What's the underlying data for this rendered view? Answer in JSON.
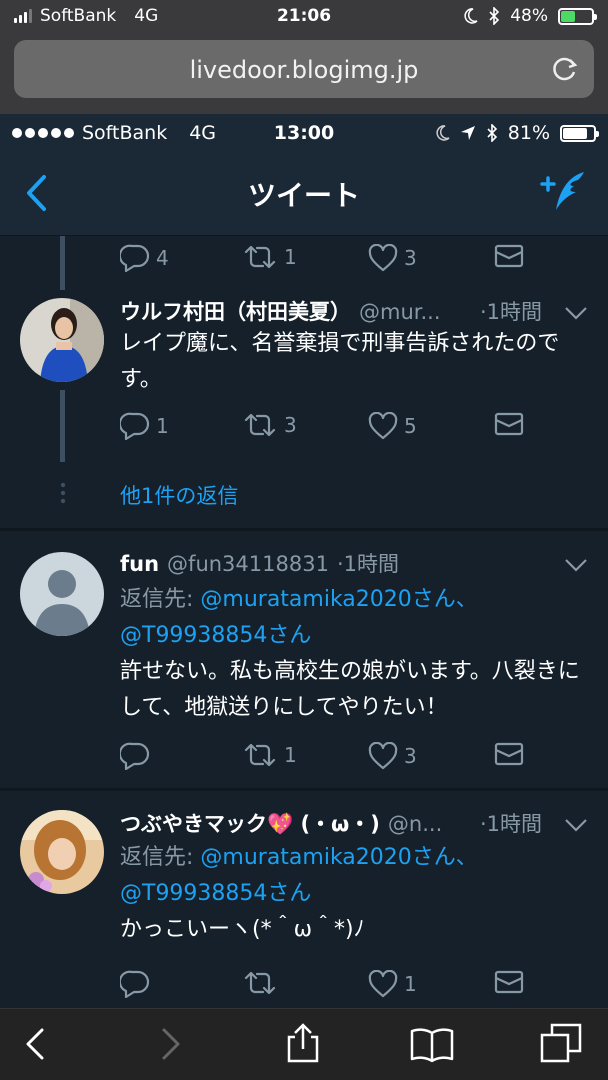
{
  "outer_status": {
    "carrier": "SoftBank",
    "network": "4G",
    "time": "21:06",
    "battery": "48%",
    "battery_color": "#4cd964"
  },
  "browser": {
    "url": "livedoor.blogimg.jp"
  },
  "inner_status": {
    "carrier": "SoftBank",
    "network": "4G",
    "time": "13:00",
    "battery": "81%"
  },
  "nav": {
    "title": "ツイート"
  },
  "top_actions": {
    "replies": "4",
    "retweets": "1",
    "likes": "3"
  },
  "tweets": [
    {
      "name": "ウルフ村田（村田美夏）",
      "handle": "@mur...",
      "time": "·1時間",
      "text": "レイプ魔に、名誉棄損で刑事告訴されたのです。",
      "replies": "1",
      "retweets": "3",
      "likes": "5"
    },
    {
      "name": "fun",
      "handle": "@fun34118831",
      "time": "·1時間",
      "reply_prefix": "返信先: ",
      "reply_mentions": "@muratamika2020さん、",
      "reply_mentions2": "@T99938854さん",
      "text": "許せない。私も高校生の娘がいます。八裂きにして、地獄送りにしてやりたい！",
      "replies": "",
      "retweets": "1",
      "likes": "3"
    },
    {
      "name": "つぶやきマック💖 (・ω・)",
      "handle": "@n...",
      "time": "·1時間",
      "reply_prefix": "返信先: ",
      "reply_mentions": "@muratamika2020さん、",
      "reply_mentions2": "@T99938854さん",
      "text": "かっこいーヽ(*＾ω＾*)ﾉ",
      "replies": "",
      "retweets": "",
      "likes": "1"
    }
  ],
  "more_replies": "他1件の返信",
  "colors": {
    "accent": "#1da1f2",
    "muted": "#8899a6",
    "bg": "#15202b"
  }
}
